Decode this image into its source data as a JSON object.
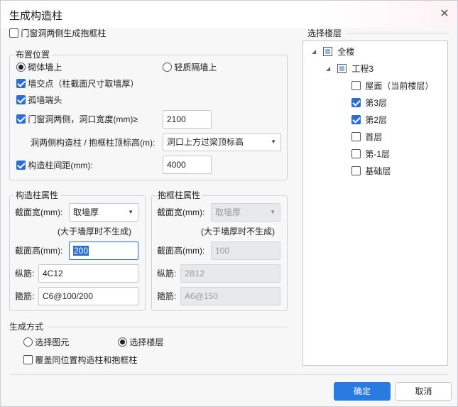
{
  "dialog": {
    "title": "生成构造柱",
    "close_icon": "close-icon"
  },
  "door_window_option": {
    "label": "门窗洞两侧生成抱框柱",
    "checked": false
  },
  "layout_position": {
    "title": "布置位置",
    "masonry_wall": {
      "label": "砌体墙上",
      "selected": true
    },
    "light_partition": {
      "label": "轻质隔墙上",
      "selected": false
    },
    "wall_intersection": {
      "label": "墙交点（柱截面尺寸取墙厚）",
      "checked": true
    },
    "isolated_wall_end": {
      "label": "孤墙端头",
      "checked": true
    },
    "door_window_sides": {
      "label": "门窗洞两侧，洞口宽度(mm)≥",
      "checked": true,
      "value": "2100"
    },
    "top_elevation": {
      "label": "洞两侧构造柱 / 抱框柱顶标高(m):",
      "value": "洞口上方过梁顶标高"
    },
    "column_spacing": {
      "label": "构造柱间距(mm):",
      "checked": true,
      "value": "4000"
    }
  },
  "construct_column": {
    "title": "构造柱属性",
    "section_width_label": "截面宽(mm):",
    "section_width_value": "取墙厚",
    "note": "(大于墙厚时不生成)",
    "section_height_label": "截面高(mm):",
    "section_height_value": "200",
    "longitudinal_label": "纵筋:",
    "longitudinal_value": "4C12",
    "stirrup_label": "箍筋:",
    "stirrup_value": "C6@100/200"
  },
  "frame_column": {
    "title": "抱框柱属性",
    "section_width_label": "截面宽(mm):",
    "section_width_value": "取墙厚",
    "note": "(大于墙厚时不生成)",
    "section_height_label": "截面高(mm):",
    "section_height_value": "100",
    "longitudinal_label": "纵筋:",
    "longitudinal_value": "2B12",
    "stirrup_label": "箍筋:",
    "stirrup_value": "A6@150"
  },
  "generate_mode": {
    "title": "生成方式",
    "select_element": {
      "label": "选择图元",
      "selected": false
    },
    "select_floor": {
      "label": "选择楼层",
      "selected": true
    },
    "overwrite": {
      "label": "覆盖同位置构造柱和抱框柱",
      "checked": false
    }
  },
  "floor_select": {
    "title": "选择楼层",
    "root": "全楼",
    "project": "工程3",
    "floors": [
      {
        "label": "屋面（当前楼层）",
        "checked": false
      },
      {
        "label": "第3层",
        "checked": true
      },
      {
        "label": "第2层",
        "checked": true
      },
      {
        "label": "首层",
        "checked": false
      },
      {
        "label": "第-1层",
        "checked": false
      },
      {
        "label": "基础层",
        "checked": false
      }
    ]
  },
  "buttons": {
    "ok": "确定",
    "cancel": "取消"
  },
  "colors": {
    "accent": "#2a7be0"
  }
}
